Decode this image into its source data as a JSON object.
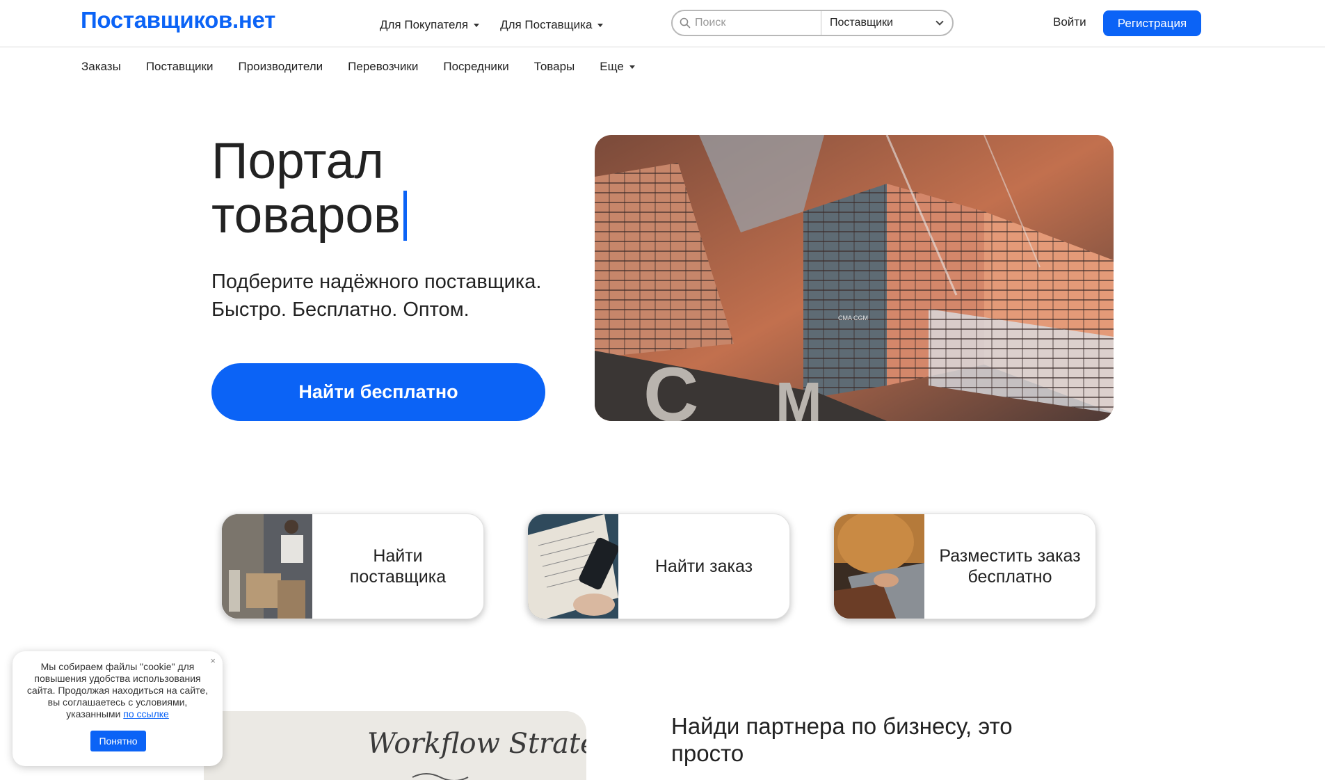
{
  "header": {
    "logo": "Поставщиков.нет",
    "nav": [
      {
        "label": "Для Покупателя"
      },
      {
        "label": "Для Поставщика"
      }
    ],
    "search": {
      "placeholder": "Поиск",
      "select_value": "Поставщики"
    },
    "login": "Войти",
    "register": "Регистрация"
  },
  "subnav": {
    "items": [
      "Заказы",
      "Поставщики",
      "Производители",
      "Перевозчики",
      "Посредники",
      "Товары"
    ],
    "more": "Еще"
  },
  "hero": {
    "title_line1": "Портал",
    "title_line2": "товаров",
    "subtitle_line1": "Подберите надёжного поставщика.",
    "subtitle_line2": "Быстро. Бесплатно. Оптом.",
    "cta": "Найти бесплатно",
    "image_lettering": "CMA CGM"
  },
  "cards": [
    {
      "line1": "Найти",
      "line2": "поставщика"
    },
    {
      "line1": "Найти заказ",
      "line2": ""
    },
    {
      "line1": "Разместить заказ",
      "line2": "бесплатно"
    }
  ],
  "bottom": {
    "partner_title_line1": "Найди партнера по бизнесу, это",
    "partner_title_line2": "просто",
    "whiteboard_text": "Workflow Strateg"
  },
  "cookie": {
    "text": "Мы собираем файлы \"cookie\" для повышения удобства использования сайта. Продолжая находиться на сайте, вы соглашаетесь с условиями, указанными",
    "link": "по ссылке",
    "close": "×",
    "ok": "Понятно"
  },
  "colors": {
    "brand": "#0b63f6",
    "text": "#222222"
  }
}
